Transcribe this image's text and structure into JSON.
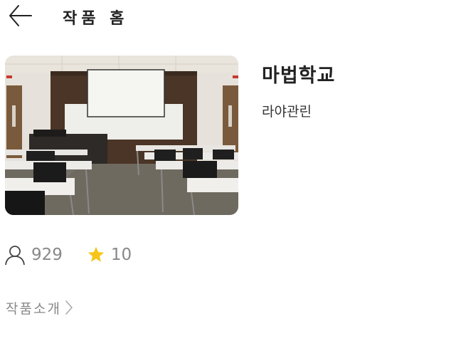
{
  "header": {
    "title": "작품 홈",
    "back_icon": "arrow-left-icon"
  },
  "work": {
    "title": "마법학교",
    "author": "라야관린",
    "cover_description_icon": "classroom-cover-image"
  },
  "stats": {
    "readers_icon": "person-icon",
    "readers": "929",
    "stars_icon": "star-icon",
    "stars": "10",
    "star_color": "#F5C518"
  },
  "intro": {
    "label": "작품소개",
    "chevron_icon": "chevron-right-icon"
  }
}
